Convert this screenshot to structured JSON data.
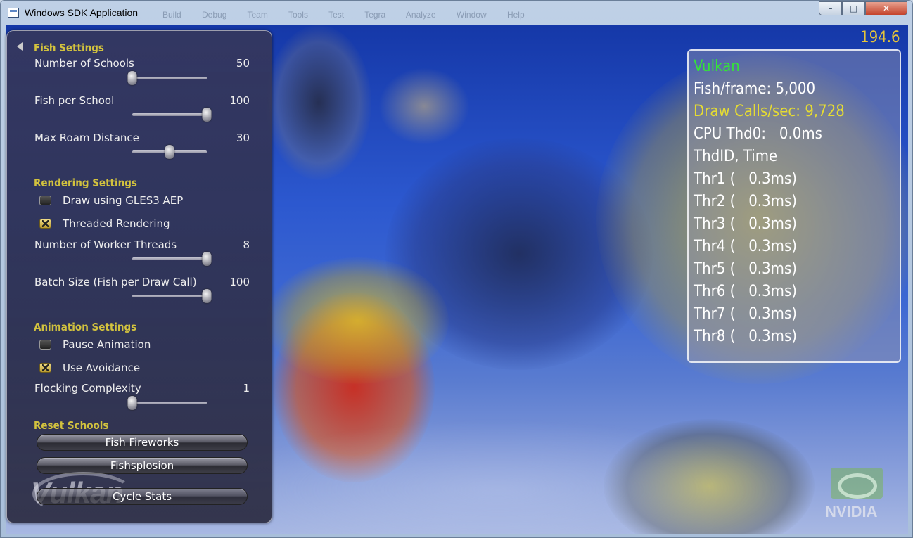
{
  "window": {
    "title": "Windows SDK Application",
    "ghost_menu": "Build Debug Team Tools Test Tegra Analyze Window Help",
    "minimize": "–",
    "maximize": "□",
    "close": "✕"
  },
  "panel": {
    "fish_settings": {
      "title": "Fish Settings",
      "sliders": [
        {
          "label": "Number of Schools",
          "value": "50",
          "fraction": 0.0
        },
        {
          "label": "Fish per School",
          "value": "100",
          "fraction": 1.0
        },
        {
          "label": "Max Roam Distance",
          "value": "30",
          "fraction": 0.5
        }
      ]
    },
    "rendering_settings": {
      "title": "Rendering Settings",
      "checkboxes": [
        {
          "label": "Draw using GLES3 AEP",
          "checked": false
        },
        {
          "label": "Threaded Rendering",
          "checked": true
        }
      ],
      "sliders": [
        {
          "label": "Number of Worker Threads",
          "value": "8",
          "fraction": 1.0
        },
        {
          "label": "Batch Size (Fish per Draw Call)",
          "value": "100",
          "fraction": 1.0
        }
      ]
    },
    "animation_settings": {
      "title": "Animation Settings",
      "checkboxes": [
        {
          "label": "Pause Animation",
          "checked": false
        },
        {
          "label": "Use Avoidance",
          "checked": true
        }
      ],
      "sliders": [
        {
          "label": "Flocking Complexity",
          "value": "1",
          "fraction": 0.0
        }
      ]
    },
    "reset_schools": {
      "title": "Reset Schools",
      "buttons": [
        "Fish Fireworks",
        "Fishsplosion",
        "Cycle Stats"
      ]
    }
  },
  "overlay": {
    "fps": "194.6",
    "stats": {
      "api": "Vulkan",
      "fish_per_frame": "Fish/frame: 5,000",
      "draw_calls": "Draw Calls/sec: 9,728",
      "cpu_thread": "CPU Thd0:   0.0ms",
      "header": "ThdID, Time",
      "threads": [
        "Thr1 (   0.3ms)",
        "Thr2 (   0.3ms)",
        "Thr3 (   0.3ms)",
        "Thr4 (   0.3ms)",
        "Thr5 (   0.3ms)",
        "Thr6 (   0.3ms)",
        "Thr7 (   0.3ms)",
        "Thr8 (   0.3ms)"
      ]
    },
    "colors": {
      "api": "#35e13a",
      "highlight": "#e6dc32",
      "normal": "#ffffff",
      "section": "#d2c23e"
    }
  },
  "logos": {
    "vulkan": "Vulkan",
    "nvidia": "NVIDIA"
  }
}
